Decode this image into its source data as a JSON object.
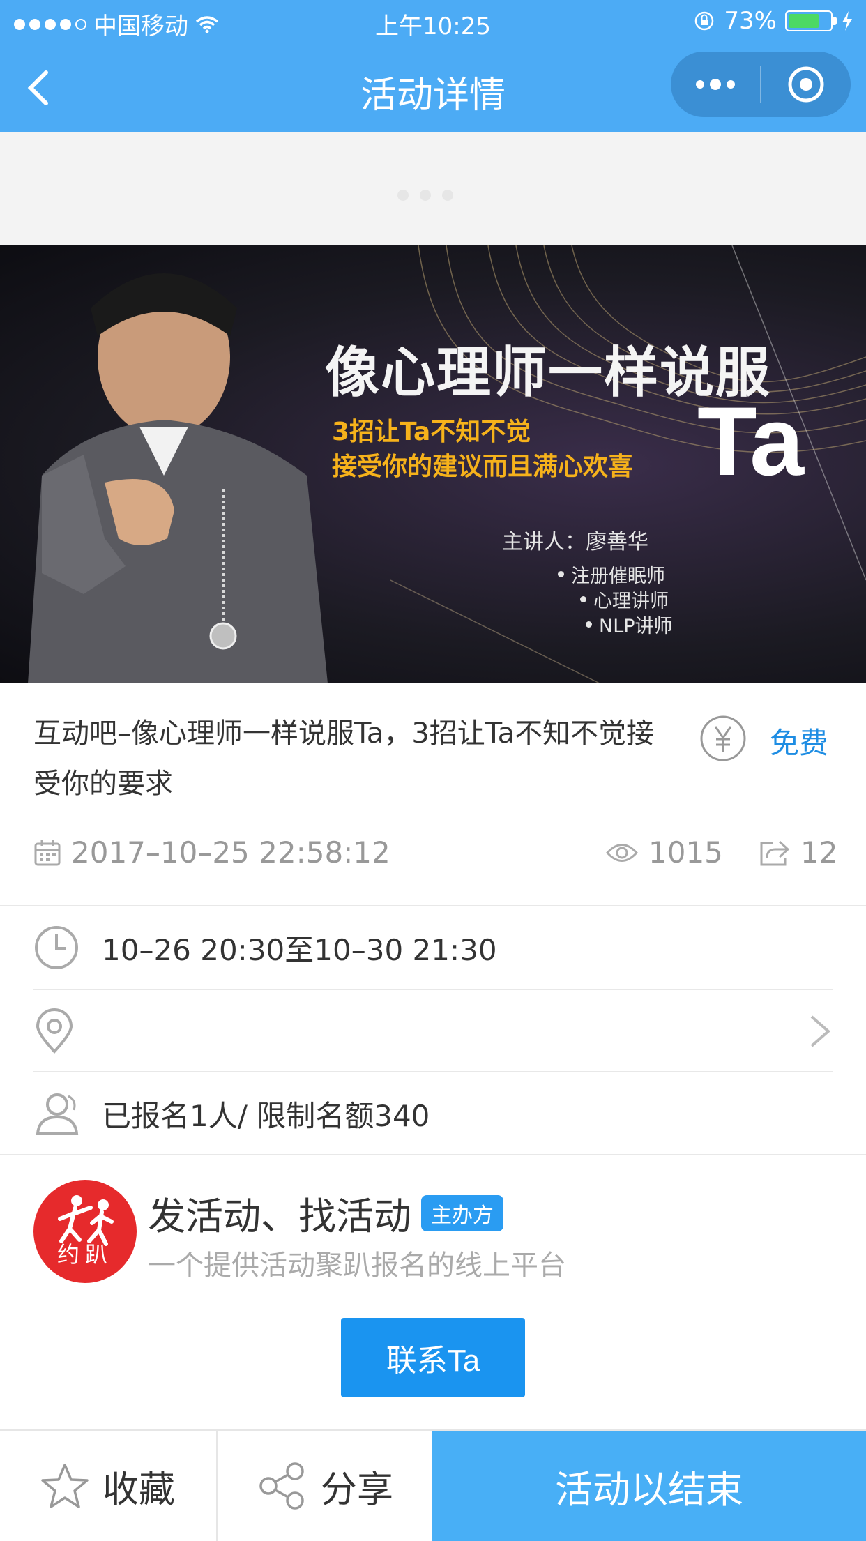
{
  "status_bar": {
    "carrier": "中国移动",
    "time": "上午10:25",
    "battery": "73%",
    "battery_level": 0.73
  },
  "navbar": {
    "title": "活动详情",
    "back_icon": "chevron-left-icon",
    "more_icon": "more-dots-icon",
    "close_icon": "target-close-icon"
  },
  "banner": {
    "headline": "像心理师一样说服",
    "big_text": "Ta",
    "sub_line1": "3招让Ta不知不觉",
    "sub_line2": "接受你的建议而且满心欢喜",
    "speaker": "主讲人：廖善华",
    "credentials": [
      "注册催眠师",
      "心理讲师",
      "NLP讲师"
    ]
  },
  "event": {
    "title": "互动吧–像心理师一样说服Ta，3招让Ta不知不觉接受你的要求",
    "fee": "免费",
    "published": "2017–10–25 22:58:12",
    "views": "1015",
    "shares": "12",
    "time_range": "10–26 20:30至10–30 21:30",
    "location": "",
    "signup": "已报名1人/ 限制名额340"
  },
  "organizer": {
    "name": "发活动、找活动",
    "badge": "主办方",
    "desc": "一个提供活动聚趴报名的线上平台",
    "logo_text": "约趴",
    "logo_color": "#e62a2c",
    "contact_label": "联系Ta"
  },
  "bottom_bar": {
    "favorite": "收藏",
    "share": "分享",
    "status": "活动以结束"
  },
  "colors": {
    "primary": "#4cabf5",
    "accent": "#1a94f0",
    "fee": "#1e8de3"
  }
}
